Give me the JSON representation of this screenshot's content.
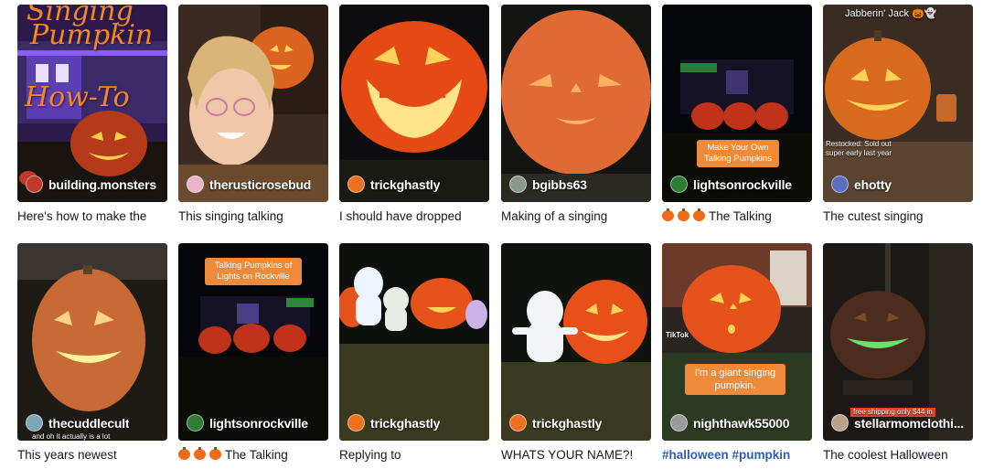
{
  "cards": [
    {
      "username": "building.monsters",
      "caption": "Here's how to make the",
      "avatar_color": "#c0392b",
      "overlay": {
        "title_line1": "Singing",
        "title_line2": "Pumpkin",
        "title_line3": "How-To"
      }
    },
    {
      "username": "therusticrosebud",
      "caption": "This singing talking",
      "avatar_color": "#e8b6c8"
    },
    {
      "username": "trickghastly",
      "caption": "I should have dropped",
      "avatar_color": "#f07020"
    },
    {
      "username": "bgibbs63",
      "caption": "Making of a singing",
      "avatar_color": "#8a9a8a"
    },
    {
      "username": "lightsonrockville",
      "caption": "The Talking",
      "caption_emoji_count": 3,
      "avatar_color": "#2e7d32",
      "overlay": {
        "label": "Make Your Own Talking Pumpkins"
      }
    },
    {
      "username": "ehotty",
      "caption": "The cutest singing",
      "avatar_color": "#5a6fbf",
      "overlay": {
        "top": "Jabberin' Jack 🎃👻",
        "note": "Restocked: Sold out super early last year"
      }
    },
    {
      "username": "thecuddlecult",
      "caption": "This years newest",
      "avatar_color": "#7fa6b5",
      "overlay": {
        "note": "and oh it actually is a lot"
      }
    },
    {
      "username": "lightsonrockville",
      "caption": "The Talking",
      "caption_emoji_count": 3,
      "avatar_color": "#2e7d32",
      "overlay": {
        "label": "Talking Pumpkins of Lights on Rockville"
      }
    },
    {
      "username": "trickghastly",
      "caption": "Replying to",
      "avatar_color": "#f07020"
    },
    {
      "username": "trickghastly",
      "caption": "WHATS YOUR NAME?!",
      "avatar_color": "#f07020"
    },
    {
      "username": "nighthawk55000",
      "caption": "#halloween #pumpkin",
      "caption_style": "hashtag",
      "avatar_color": "#9a9a9a",
      "overlay": {
        "label": "I'm a giant singing pumpkin.",
        "watermark": "TikTok"
      }
    },
    {
      "username": "stellarmomclothi...",
      "caption": "The coolest Halloween",
      "avatar_color": "#b9a38a",
      "overlay": {
        "note": "free shipping only $44 in"
      }
    }
  ]
}
